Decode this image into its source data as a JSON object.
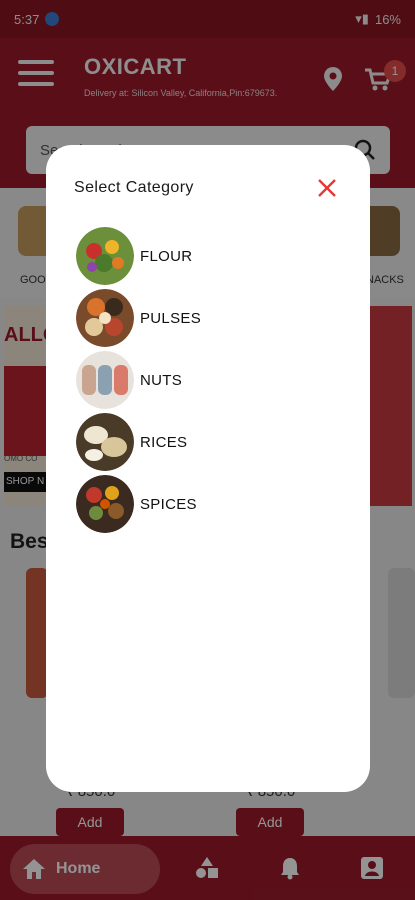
{
  "status": {
    "time": "5:37",
    "battery": "16%"
  },
  "app": {
    "title": "OXICART",
    "delivery": "Delivery at: Silicon Valley, California,Pin:679673."
  },
  "header": {
    "cart_count": "1"
  },
  "search": {
    "placeholder": "Search products"
  },
  "categories_bg": {
    "left_label": "GOO",
    "right_label": "NACKS"
  },
  "banner": {
    "left_word": "ALLO",
    "left_cta": "SHOP N",
    "left_promo": "OMO CO"
  },
  "best": {
    "title": "Best"
  },
  "products": [
    {
      "price": "₹ 850.0",
      "add_label": "Add"
    },
    {
      "price": "₹ 850.0",
      "add_label": "Add"
    }
  ],
  "nav": {
    "home_label": "Home"
  },
  "modal": {
    "title": "Select  Category",
    "items": [
      {
        "label": "FLOUR"
      },
      {
        "label": "PULSES"
      },
      {
        "label": "NUTS"
      },
      {
        "label": "RICES"
      },
      {
        "label": "SPICES"
      }
    ]
  },
  "colors": {
    "brand": "#9b1b2a",
    "close": "#e53935",
    "badge": "#e34b4b"
  }
}
